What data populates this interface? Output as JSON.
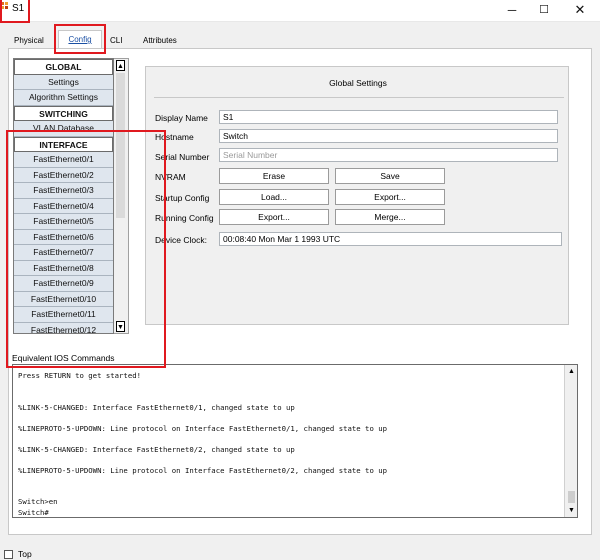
{
  "window": {
    "title": "S1",
    "app_icon": "packet-tracer-device-icon",
    "controls": {
      "minimize": "─",
      "maximize": "☐",
      "close": "✕"
    }
  },
  "tabs": [
    {
      "label": "Physical",
      "active": false
    },
    {
      "label": "Config",
      "active": true
    },
    {
      "label": "CLI",
      "active": false
    },
    {
      "label": "Attributes",
      "active": false
    }
  ],
  "sidebar": {
    "items": [
      {
        "label": "GLOBAL",
        "heading": true
      },
      {
        "label": "Settings",
        "heading": false
      },
      {
        "label": "Algorithm Settings",
        "heading": false
      },
      {
        "label": "SWITCHING",
        "heading": true
      },
      {
        "label": "VLAN Database",
        "heading": false
      },
      {
        "label": "INTERFACE",
        "heading": true
      },
      {
        "label": "FastEthernet0/1",
        "heading": false
      },
      {
        "label": "FastEthernet0/2",
        "heading": false
      },
      {
        "label": "FastEthernet0/3",
        "heading": false
      },
      {
        "label": "FastEthernet0/4",
        "heading": false
      },
      {
        "label": "FastEthernet0/5",
        "heading": false
      },
      {
        "label": "FastEthernet0/6",
        "heading": false
      },
      {
        "label": "FastEthernet0/7",
        "heading": false
      },
      {
        "label": "FastEthernet0/8",
        "heading": false
      },
      {
        "label": "FastEthernet0/9",
        "heading": false
      },
      {
        "label": "FastEthernet0/10",
        "heading": false
      },
      {
        "label": "FastEthernet0/11",
        "heading": false
      },
      {
        "label": "FastEthernet0/12",
        "heading": false
      }
    ]
  },
  "global_settings": {
    "title": "Global Settings",
    "display_name_label": "Display Name",
    "display_name_value": "S1",
    "hostname_label": "Hostname",
    "hostname_value": "Switch",
    "serial_label": "Serial Number",
    "serial_placeholder": "Serial Number",
    "nvram_label": "NVRAM",
    "erase_label": "Erase",
    "save_label": "Save",
    "startup_label": "Startup Config",
    "load_label": "Load...",
    "export_label": "Export...",
    "running_label": "Running Config",
    "running_export_label": "Export...",
    "merge_label": "Merge...",
    "clock_label": "Device Clock:",
    "clock_value": "00:08:40 Mon Mar 1 1993 UTC"
  },
  "console": {
    "label": "Equivalent IOS Commands",
    "lines": [
      "Press RETURN to get started!",
      "",
      "",
      "%LINK-5-CHANGED: Interface FastEthernet0/1, changed state to up",
      "",
      "%LINEPROTO-5-UPDOWN: Line protocol on Interface FastEthernet0/1, changed state to up",
      "",
      "%LINK-5-CHANGED: Interface FastEthernet0/2, changed state to up",
      "",
      "%LINEPROTO-5-UPDOWN: Line protocol on Interface FastEthernet0/2, changed state to up",
      "",
      "",
      "Switch>en",
      "Switch#"
    ]
  },
  "footer": {
    "top_label": "Top",
    "top_checked": false
  },
  "colors": {
    "highlight": "#e0191f",
    "nav_item_bg": "#dfe6ee",
    "active_tab_text": "#1a4fa3"
  }
}
